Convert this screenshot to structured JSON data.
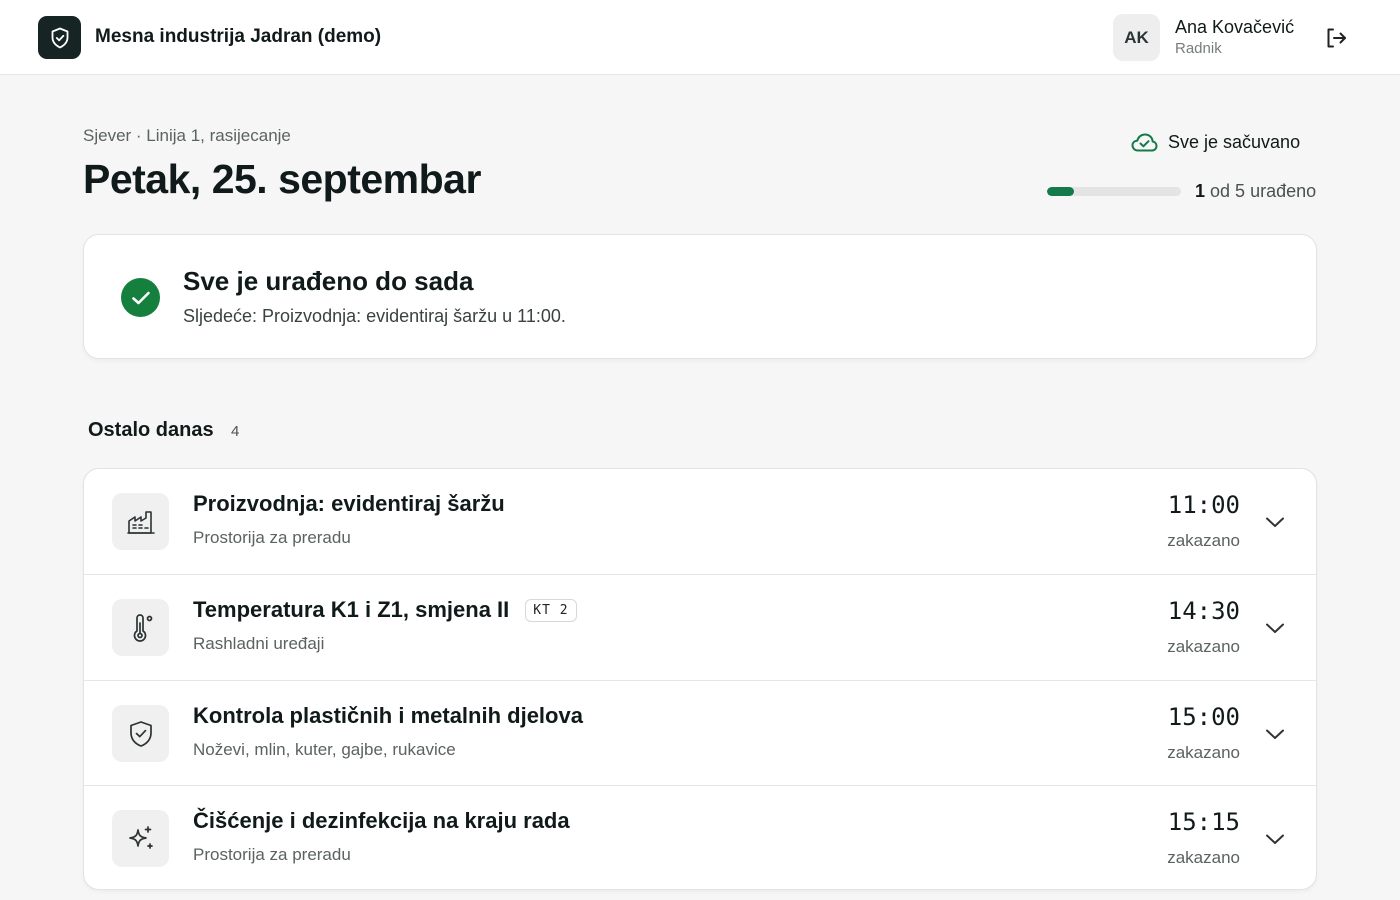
{
  "header": {
    "app_title": "Mesna industrija Jadran (demo)",
    "user_initials": "AK",
    "user_name": "Ana Kovačević",
    "user_role": "Radnik"
  },
  "page": {
    "breadcrumb": "Sjever · Linija 1, rasijecanje",
    "title": "Petak, 25. septembar",
    "saved_text": "Sve je sačuvano",
    "progress": {
      "done": 1,
      "total": 5,
      "done_label": "1",
      "suffix": "od 5 urađeno"
    }
  },
  "done_card": {
    "title": "Sve je urađeno do sada",
    "subtitle": "Sljedeće: Proizvodnja: evidentiraj šaržu u 11:00."
  },
  "section": {
    "title": "Ostalo danas",
    "count": "4"
  },
  "tasks": [
    {
      "title": "Proizvodnja: evidentiraj šaržu",
      "subtitle": "Prostorija za preradu",
      "time": "11:00",
      "status": "zakazano",
      "icon": "factory-icon",
      "tag": ""
    },
    {
      "title": "Temperatura K1 i Z1, smjena II",
      "subtitle": "Rashladni uređaji",
      "time": "14:30",
      "status": "zakazano",
      "icon": "thermometer-icon",
      "tag": "KT 2"
    },
    {
      "title": "Kontrola plastičnih i metalnih djelova",
      "subtitle": "Noževi, mlin, kuter, gajbe, rukavice",
      "time": "15:00",
      "status": "zakazano",
      "icon": "shield-check-icon",
      "tag": ""
    },
    {
      "title": "Čišćenje i dezinfekcija na kraju rada",
      "subtitle": "Prostorija za preradu",
      "time": "15:15",
      "status": "zakazano",
      "icon": "sparkles-icon",
      "tag": ""
    }
  ],
  "colors": {
    "accent": "#157a4a",
    "logo_bg": "#162524"
  }
}
